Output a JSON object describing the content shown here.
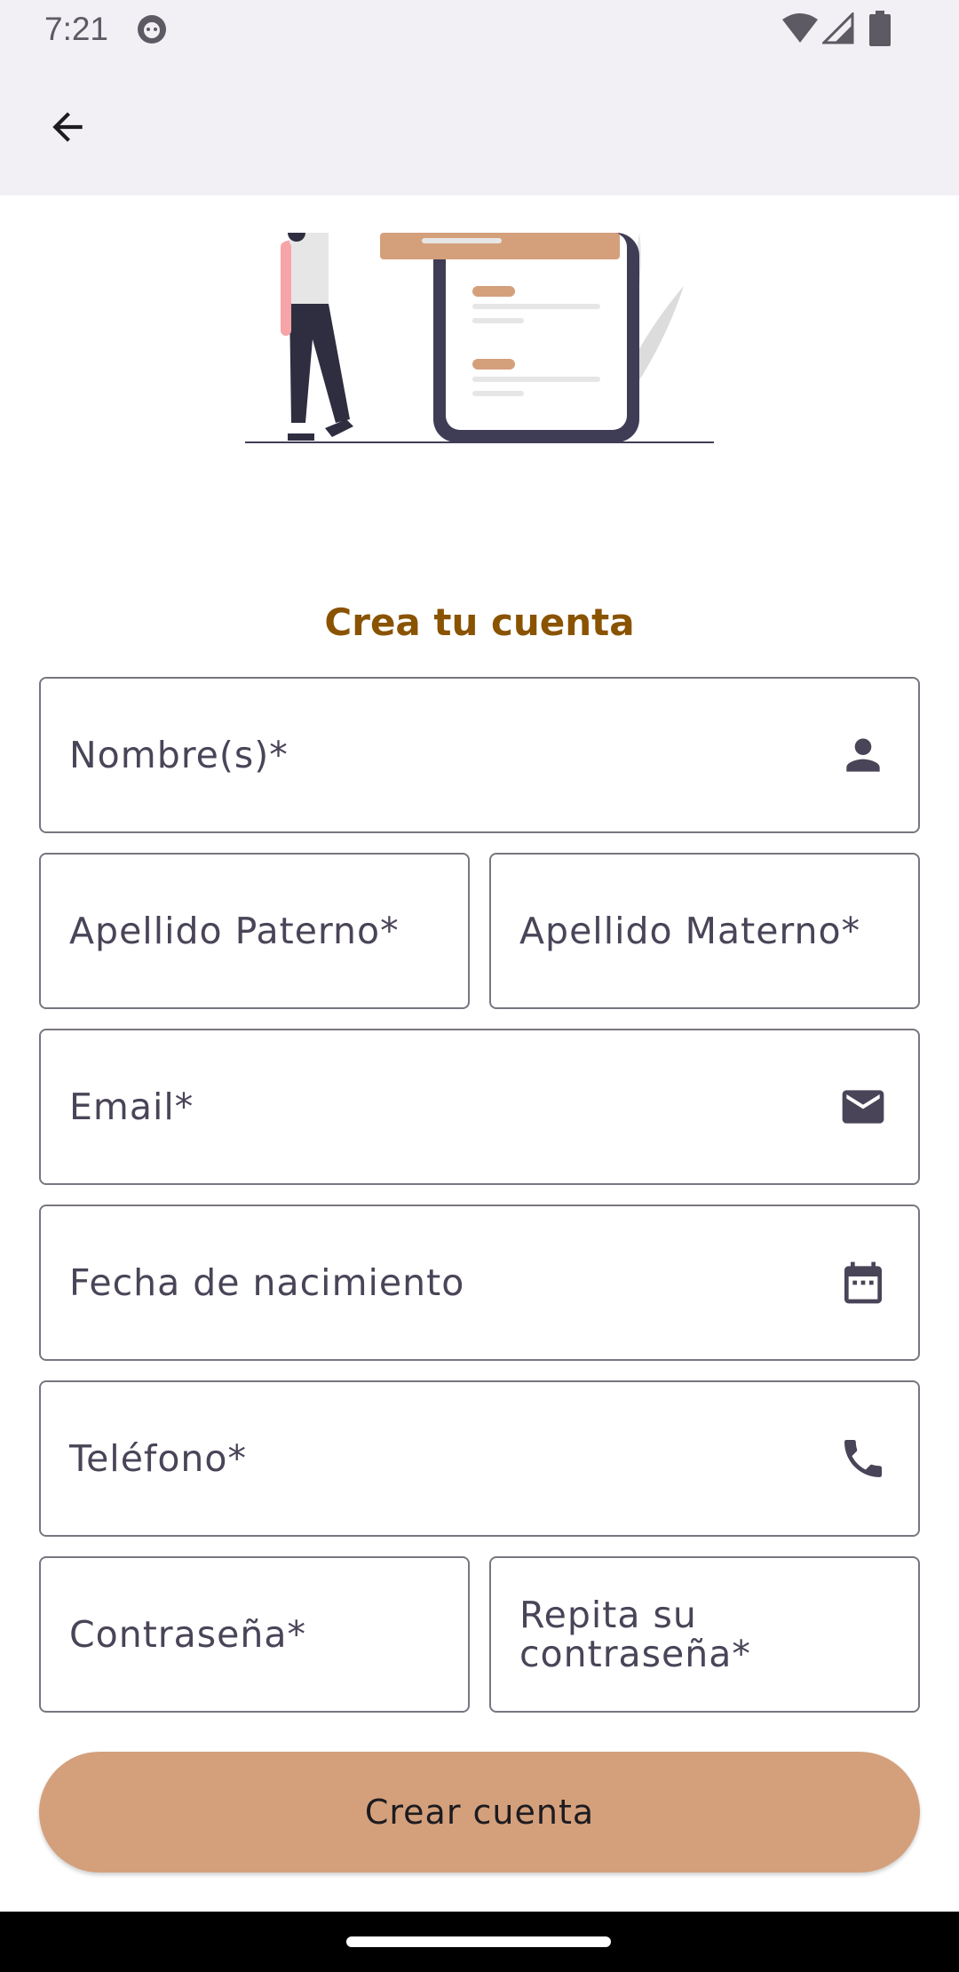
{
  "status_bar": {
    "time": "7:21"
  },
  "title": "Crea tu cuenta",
  "fields": {
    "nombre": "Nombre(s)*",
    "apellido_paterno": "Apellido Paterno*",
    "apellido_materno": "Apellido Materno*",
    "email": "Email*",
    "fecha_nacimiento": "Fecha de nacimiento",
    "telefono": "Teléfono*",
    "contrasena": "Contraseña*",
    "repita_contrasena": "Repita su contraseña*"
  },
  "submit_label": "Crear cuenta",
  "icons": {
    "back": "arrow-back-icon",
    "nombre": "person-icon",
    "email": "mail-icon",
    "fecha": "calendar-icon",
    "telefono": "phone-icon"
  },
  "colors": {
    "accent": "#d4a07c",
    "title": "#8a5300",
    "appbar": "#f2f0f5"
  }
}
